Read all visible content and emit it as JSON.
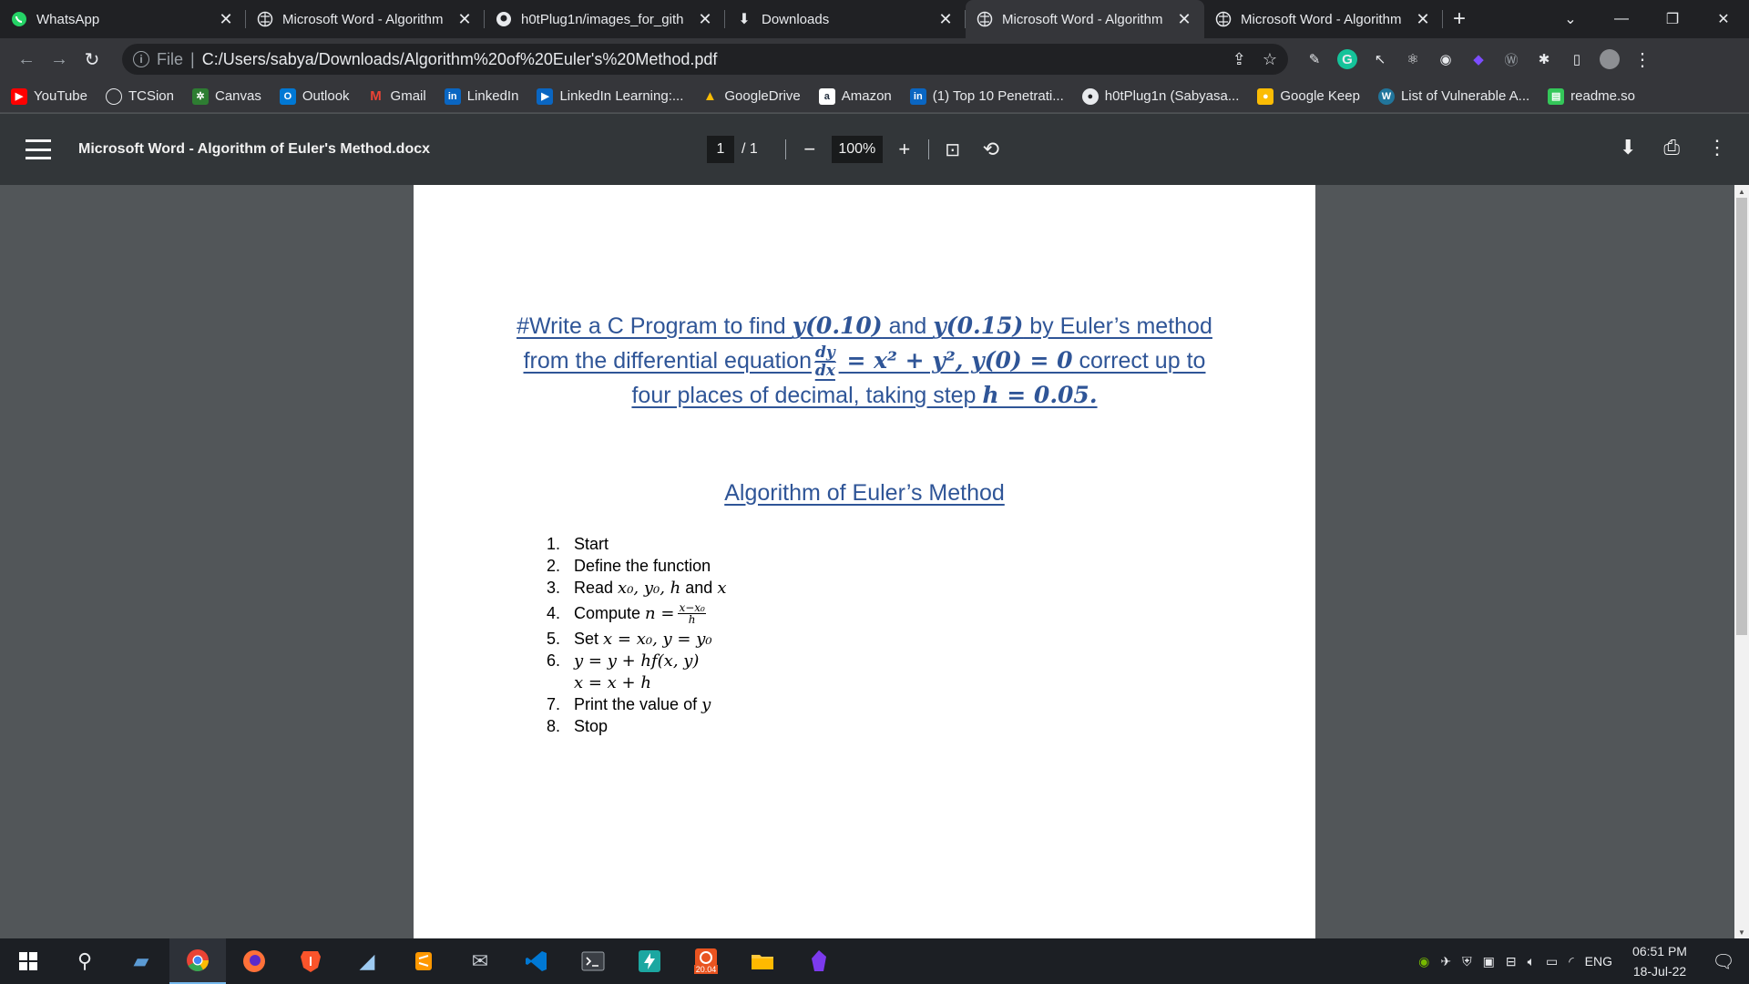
{
  "browser": {
    "tabs": [
      {
        "title": "WhatsApp",
        "icon": "whatsapp-icon",
        "active": false
      },
      {
        "title": "Microsoft Word - Algorithm",
        "icon": "globe-icon",
        "active": false
      },
      {
        "title": "h0tPlug1n/images_for_gith",
        "icon": "github-icon",
        "active": false
      },
      {
        "title": "Downloads",
        "icon": "download-icon",
        "active": false
      },
      {
        "title": "Microsoft Word - Algorithm",
        "icon": "globe-icon",
        "active": true
      },
      {
        "title": "Microsoft Word - Algorithm",
        "icon": "globe-icon",
        "active": false
      }
    ],
    "address": {
      "scheme": "File",
      "url": "C:/Users/sabya/Downloads/Algorithm%20of%20Euler's%20Method.pdf"
    },
    "bookmarks": [
      {
        "label": "YouTube",
        "icon": "youtube-icon",
        "color": "#ff0000"
      },
      {
        "label": "TCSion",
        "icon": "globe-icon",
        "color": "#5f6368"
      },
      {
        "label": "Canvas",
        "icon": "canvas-icon",
        "color": "#2e7d32"
      },
      {
        "label": "Outlook",
        "icon": "outlook-icon",
        "color": "#0078d4"
      },
      {
        "label": "Gmail",
        "icon": "gmail-icon",
        "color": "#ea4335"
      },
      {
        "label": "LinkedIn",
        "icon": "linkedin-icon",
        "color": "#0a66c2"
      },
      {
        "label": "LinkedIn Learning:...",
        "icon": "linkedin-learning-icon",
        "color": "#0a66c2"
      },
      {
        "label": "GoogleDrive",
        "icon": "google-drive-icon",
        "color": "#fbbc04"
      },
      {
        "label": "Amazon",
        "icon": "amazon-icon",
        "color": "#232f3e"
      },
      {
        "label": "(1) Top 10 Penetrati...",
        "icon": "linkedin-icon",
        "color": "#0a66c2"
      },
      {
        "label": "h0tPlug1n (Sabyasa...",
        "icon": "github-icon",
        "color": "#ffffff"
      },
      {
        "label": "Google Keep",
        "icon": "google-keep-icon",
        "color": "#fbbc04"
      },
      {
        "label": "List of Vulnerable A...",
        "icon": "wordpress-icon",
        "color": "#21759b"
      },
      {
        "label": "readme.so",
        "icon": "readme-icon",
        "color": "#34c759"
      }
    ]
  },
  "pdf": {
    "title": "Microsoft Word - Algorithm of Euler's Method.docx",
    "page_current": "1",
    "page_total": "/ 1",
    "zoom": "100%",
    "heading_line1_a": "#Write a C Program to find ",
    "heading_line1_b": "y(0.10)",
    "heading_line1_c": " and ",
    "heading_line1_d": "y(0.15)",
    "heading_line1_e": " by Euler’s method",
    "heading_line2_a": "from the differential equation",
    "heading_line2_num": "dy",
    "heading_line2_den": "dx",
    "heading_line2_b": " = x² + y², y(0) = 0",
    "heading_line2_c": " correct up to",
    "heading_line3_a": "four places of decimal, taking step ",
    "heading_line3_b": "h = 0.05.",
    "subheading": "Algorithm of Euler’s Method",
    "steps": [
      {
        "n": "1.",
        "text": "Start"
      },
      {
        "n": "2.",
        "text": "Define the function"
      },
      {
        "n": "3.",
        "text": "Read ",
        "math": "x₀, y₀, h",
        "text2": " and ",
        "math2": "x"
      },
      {
        "n": "4.",
        "text": "Compute ",
        "math": "n =",
        "frac_num": "x−x₀",
        "frac_den": "h"
      },
      {
        "n": "5.",
        "text": "Set ",
        "math": "x = x₀, y = y₀"
      },
      {
        "n": "6.",
        "math": "y = y + hf(x, y)",
        "cont": "x = x + h"
      },
      {
        "n": "7.",
        "text": "Print the value of ",
        "math": "y"
      },
      {
        "n": "8.",
        "text": "Stop"
      }
    ]
  },
  "taskbar": {
    "language": "ENG",
    "time": "06:51 PM",
    "date": "18-Jul-22",
    "badge_label": "20.04"
  },
  "colors": {
    "heading": "#2f5597",
    "page_bg": "#ffffff",
    "viewer_bg": "#525659"
  }
}
